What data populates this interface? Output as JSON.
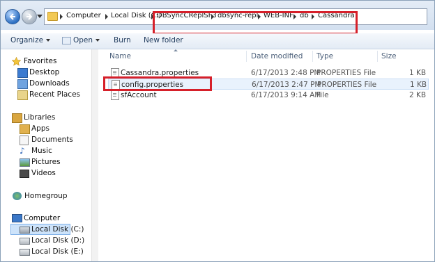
{
  "address": {
    "crumbs": [
      "Computer",
      "Local Disk (C:)",
      "DBSyncCReplSF3",
      "dbsync-repl",
      "WEB-INF",
      "db",
      "Cassandra"
    ]
  },
  "toolbar": {
    "organize": "Organize",
    "open": "Open",
    "burn": "Burn",
    "new_folder": "New folder"
  },
  "nav": {
    "favorites": "Favorites",
    "desktop": "Desktop",
    "downloads": "Downloads",
    "recent": "Recent Places",
    "libraries": "Libraries",
    "apps": "Apps",
    "documents": "Documents",
    "music": "Music",
    "pictures": "Pictures",
    "videos": "Videos",
    "homegroup": "Homegroup",
    "computer": "Computer",
    "disk_c": "Local Disk (C:)",
    "disk_d": "Local Disk (D:)",
    "disk_e": "Local Disk (E:)"
  },
  "columns": {
    "name": "Name",
    "date": "Date modified",
    "type": "Type",
    "size": "Size"
  },
  "files": [
    {
      "name": "Cassandra.properties",
      "date": "6/17/2013 2:48 PM",
      "type": "PROPERTIES File",
      "size": "1 KB"
    },
    {
      "name": "config.properties",
      "date": "6/17/2013 2:47 PM",
      "type": "PROPERTIES File",
      "size": "1 KB"
    },
    {
      "name": "sfAccount",
      "date": "6/17/2013 9:14 AM",
      "type": "File",
      "size": "2 KB"
    }
  ],
  "colors": {
    "highlight_red": "#d6202a",
    "selection_blue": "#cde3fa"
  }
}
